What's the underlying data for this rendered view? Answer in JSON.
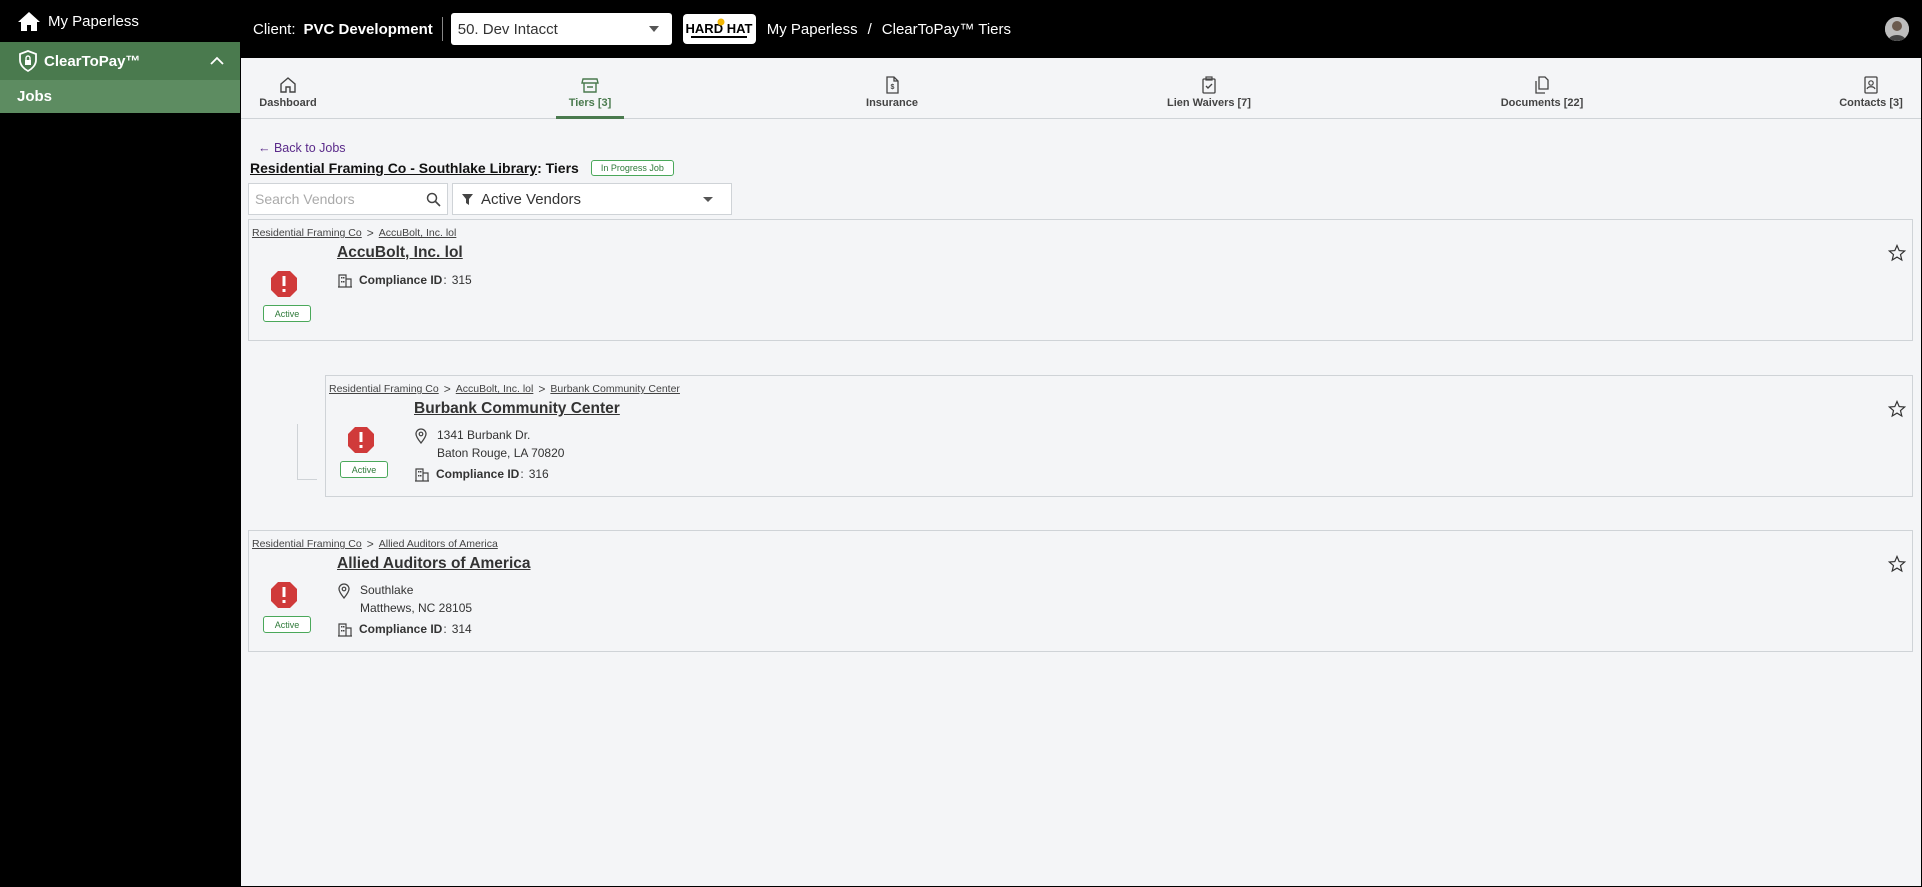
{
  "sidebar": {
    "top_label": "My Paperless",
    "app_label": "ClearToPay™",
    "items": [
      {
        "label": "Jobs"
      }
    ]
  },
  "topbar": {
    "client_label": "Client:",
    "client_name": "PVC Development",
    "company_select": "50. Dev Intacct",
    "logo_text": "HARD HAT",
    "breadcrumb": [
      "My Paperless",
      "/",
      "ClearToPay™ Tiers"
    ]
  },
  "tabs": [
    {
      "label": "Dashboard",
      "icon": "home-icon"
    },
    {
      "label": "Tiers [3]",
      "icon": "store-icon",
      "active": true
    },
    {
      "label": "Insurance",
      "icon": "insurance-doc-icon"
    },
    {
      "label": "Lien Waivers [7]",
      "icon": "clipboard-check-icon"
    },
    {
      "label": "Documents [22]",
      "icon": "documents-icon"
    },
    {
      "label": "Contacts [3]",
      "icon": "contacts-book-icon"
    }
  ],
  "page": {
    "back_link": "← Back to Jobs",
    "job_name": "Residential Framing Co - Southlake Library",
    "title_suffix": ": Tiers",
    "job_status": "In Progress Job",
    "search_placeholder": "Search Vendors",
    "filter_value": "Active Vendors"
  },
  "vendors": [
    {
      "crumbs": [
        "Residential Framing Co",
        "AccuBolt, Inc. lol"
      ],
      "name": "AccuBolt, Inc. lol",
      "status": "Active",
      "address": [],
      "compliance_label": "Compliance ID",
      "compliance_id": "315"
    },
    {
      "crumbs": [
        "Residential Framing Co",
        "AccuBolt, Inc. lol",
        "Burbank Community Center"
      ],
      "name": "Burbank Community Center",
      "status": "Active",
      "address": [
        "1341 Burbank Dr.",
        "Baton Rouge, LA 70820"
      ],
      "compliance_label": "Compliance ID",
      "compliance_id": "316"
    },
    {
      "crumbs": [
        "Residential Framing Co",
        "Allied Auditors of America"
      ],
      "name": "Allied Auditors of America",
      "status": "Active",
      "address": [
        "Southlake",
        "Matthews, NC 28105"
      ],
      "compliance_label": "Compliance ID",
      "compliance_id": "314"
    }
  ],
  "colors": {
    "accent": "#4a7a4e",
    "alert": "#d03a3a",
    "badge_green": "#4aa85a"
  }
}
